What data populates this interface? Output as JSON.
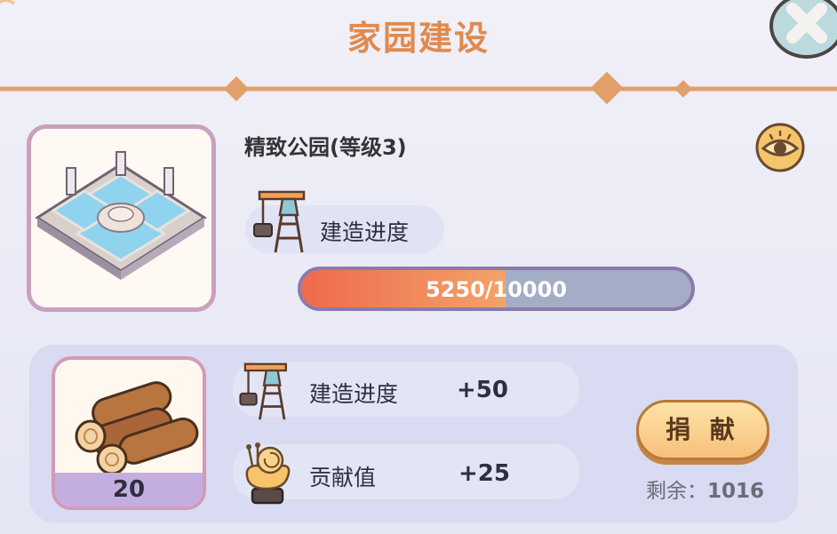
{
  "header": {
    "title": "家园建设"
  },
  "building": {
    "name": "精致公园(等级3)",
    "progress_label": "建造进度",
    "progress_current": 5250,
    "progress_max": 10000,
    "progress_text": "5250/10000"
  },
  "donation": {
    "resource_icon": "wood-logs-icon",
    "resource_count": "20",
    "rewards": [
      {
        "icon": "crane-icon",
        "label": "建造进度",
        "value": "+50"
      },
      {
        "icon": "snail-statue-icon",
        "label": "贡献值",
        "value": "+25"
      }
    ],
    "donate_label": "捐 献",
    "remaining_label": "剩余：",
    "remaining_value": "1016"
  },
  "colors": {
    "title": "#e08a4e",
    "progress_fill": "#ef6a4d",
    "progress_track": "#a3adc6",
    "button": "#f7c07a"
  }
}
